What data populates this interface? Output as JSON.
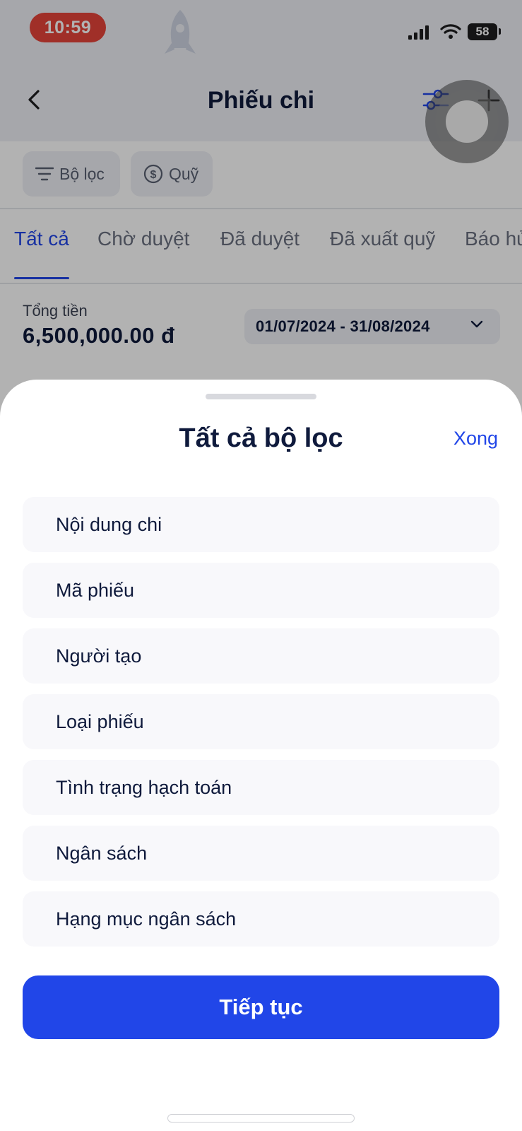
{
  "status_bar": {
    "time": "10:59",
    "battery": "58"
  },
  "nav": {
    "title": "Phiếu chi"
  },
  "filter_chips": [
    {
      "label": "Bộ lọc",
      "icon": "filter-icon"
    },
    {
      "label": "Quỹ",
      "icon": "dollar-circle-icon"
    }
  ],
  "tabs": [
    {
      "label": "Tất cả",
      "active": true
    },
    {
      "label": "Chờ duyệt",
      "active": false
    },
    {
      "label": "Đã duyệt",
      "active": false
    },
    {
      "label": "Đã xuất quỹ",
      "active": false
    },
    {
      "label": "Báo hủy",
      "active": false
    }
  ],
  "summary": {
    "total_label": "Tổng tiền",
    "total_value": "6,500,000.00 đ",
    "date_range": "01/07/2024 - 31/08/2024"
  },
  "sheet": {
    "title": "Tất cả bộ lọc",
    "done_label": "Xong",
    "items": [
      "Nội dung chi",
      "Mã phiếu",
      "Người tạo",
      "Loại phiếu",
      "Tình trạng hạch toán",
      "Ngân sách",
      "Hạng mục ngân sách"
    ],
    "continue_label": "Tiếp tục"
  },
  "colors": {
    "accent": "#2146e8",
    "title": "#0f1a3c",
    "time_pill": "#e5443a",
    "item_bg": "#f8f8fb"
  }
}
